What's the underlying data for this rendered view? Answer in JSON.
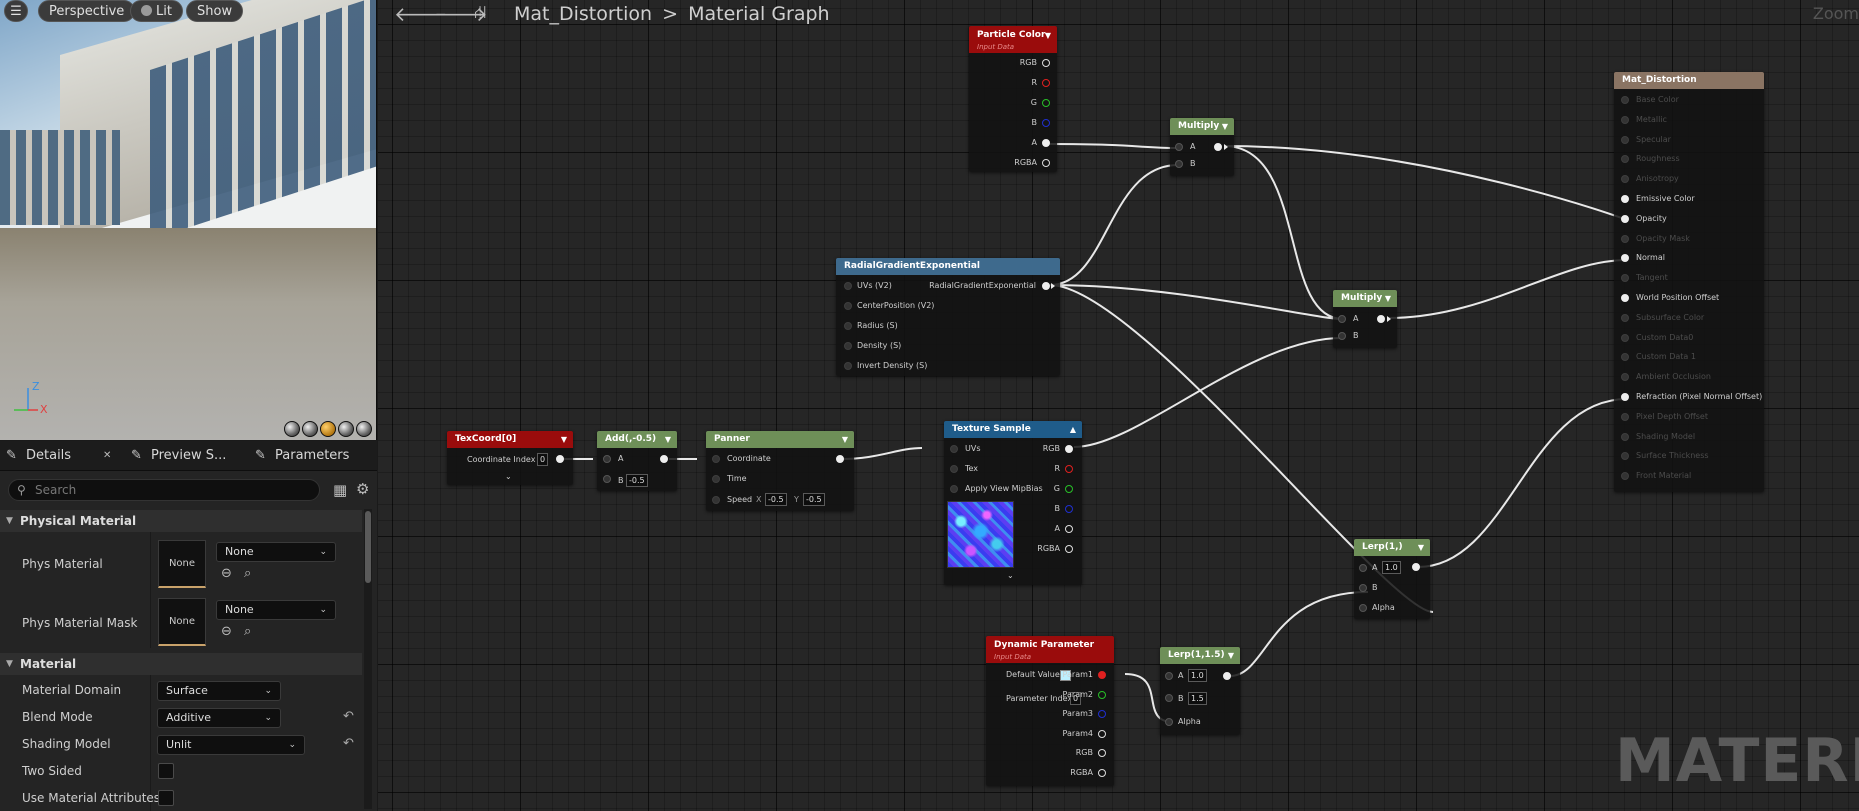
{
  "viewport": {
    "buttons": {
      "menu_icon": "hamburger-icon",
      "perspective": "Perspective",
      "lit": "Lit",
      "show": "Show"
    },
    "axis": {
      "z": "Z",
      "x": "X",
      "z_color": "#3a8fe0",
      "x_color": "#e04040",
      "y_color": "#40c040"
    }
  },
  "details_panel": {
    "tabs": [
      {
        "label": "Details",
        "icon": "pencil-icon",
        "closable": true
      },
      {
        "label": "Preview S...",
        "icon": "pencil-icon"
      },
      {
        "label": "Parameters",
        "icon": "pencil-icon"
      }
    ],
    "close_glyph": "✕",
    "search_placeholder": "Search",
    "sections": {
      "physical_material": "Physical Material",
      "material": "Material"
    },
    "props": {
      "phys_material": {
        "label": "Phys Material",
        "thumb": "None",
        "value": "None"
      },
      "phys_material_mask": {
        "label": "Phys Material Mask",
        "thumb": "None",
        "value": "None"
      },
      "material_domain": {
        "label": "Material Domain",
        "value": "Surface"
      },
      "blend_mode": {
        "label": "Blend Mode",
        "value": "Additive"
      },
      "shading_model": {
        "label": "Shading Model",
        "value": "Unlit"
      },
      "two_sided": {
        "label": "Two Sided",
        "checked": false
      },
      "use_material_attributes": {
        "label": "Use Material Attributes",
        "checked": false
      }
    }
  },
  "graph": {
    "breadcrumb": {
      "asset": "Mat_Distortion",
      "separator": ">",
      "view": "Material Graph"
    },
    "zoom_label": "Zoom",
    "watermark": "MATERIAL",
    "nodes": {
      "particle_color": {
        "title": "Particle Color",
        "subtitle": "Input Data",
        "outputs": [
          "RGB",
          "R",
          "G",
          "B",
          "A",
          "RGBA"
        ]
      },
      "multiply_1": {
        "title": "Multiply",
        "inputs": [
          "A",
          "B"
        ]
      },
      "multiply_2": {
        "title": "Multiply",
        "inputs": [
          "A",
          "B"
        ]
      },
      "radial": {
        "title": "RadialGradientExponential",
        "inputs": [
          "UVs (V2)",
          "CenterPosition (V2)",
          "Radius (S)",
          "Density (S)",
          "Invert Density (S)"
        ],
        "output": "RadialGradientExponential"
      },
      "texcoord": {
        "title": "TexCoord[0]",
        "prop_label": "Coordinate Index",
        "prop_value": "0"
      },
      "add": {
        "title": "Add(,-0.5)",
        "inputs": [
          "A",
          "B"
        ],
        "b_value": "-0.5"
      },
      "panner": {
        "title": "Panner",
        "inputs": [
          "Coordinate",
          "Time",
          "Speed"
        ],
        "speed_x_label": "X",
        "speed_x": "-0.5",
        "speed_y_label": "Y",
        "speed_y": "-0.5"
      },
      "texture_sample": {
        "title": "Texture Sample",
        "inputs": [
          "UVs",
          "Tex",
          "Apply View MipBias"
        ],
        "outputs": [
          "RGB",
          "R",
          "G",
          "B",
          "A",
          "RGBA"
        ]
      },
      "lerp_1": {
        "title": "Lerp(1,)",
        "inputs": [
          "A",
          "B",
          "Alpha"
        ],
        "a_value": "1.0"
      },
      "lerp_2": {
        "title": "Lerp(1,1.5)",
        "inputs": [
          "A",
          "B",
          "Alpha"
        ],
        "a_value": "1.0",
        "b_value": "1.5"
      },
      "dynamic_param": {
        "title": "Dynamic Parameter",
        "subtitle": "Input Data",
        "default_label": "Default Value",
        "index_label": "Parameter Index",
        "index_value": "0",
        "outputs": [
          "Param1",
          "Param2",
          "Param3",
          "Param4",
          "RGB",
          "RGBA"
        ]
      },
      "result": {
        "title": "Mat_Distortion",
        "inputs": [
          {
            "label": "Base Color",
            "active": false
          },
          {
            "label": "Metallic",
            "active": false
          },
          {
            "label": "Specular",
            "active": false
          },
          {
            "label": "Roughness",
            "active": false
          },
          {
            "label": "Anisotropy",
            "active": false
          },
          {
            "label": "Emissive Color",
            "active": true
          },
          {
            "label": "Opacity",
            "active": true
          },
          {
            "label": "Opacity Mask",
            "active": false
          },
          {
            "label": "Normal",
            "active": true
          },
          {
            "label": "Tangent",
            "active": false
          },
          {
            "label": "World Position Offset",
            "active": true
          },
          {
            "label": "Subsurface Color",
            "active": false
          },
          {
            "label": "Custom Data0",
            "active": false
          },
          {
            "label": "Custom Data 1",
            "active": false
          },
          {
            "label": "Ambient Occlusion",
            "active": false
          },
          {
            "label": "Refraction (Pixel Normal Offset)",
            "active": true
          },
          {
            "label": "Pixel Depth Offset",
            "active": false
          },
          {
            "label": "Shading Model",
            "active": false
          },
          {
            "label": "Surface Thickness",
            "active": false
          },
          {
            "label": "Front Material",
            "active": false
          }
        ]
      }
    }
  }
}
